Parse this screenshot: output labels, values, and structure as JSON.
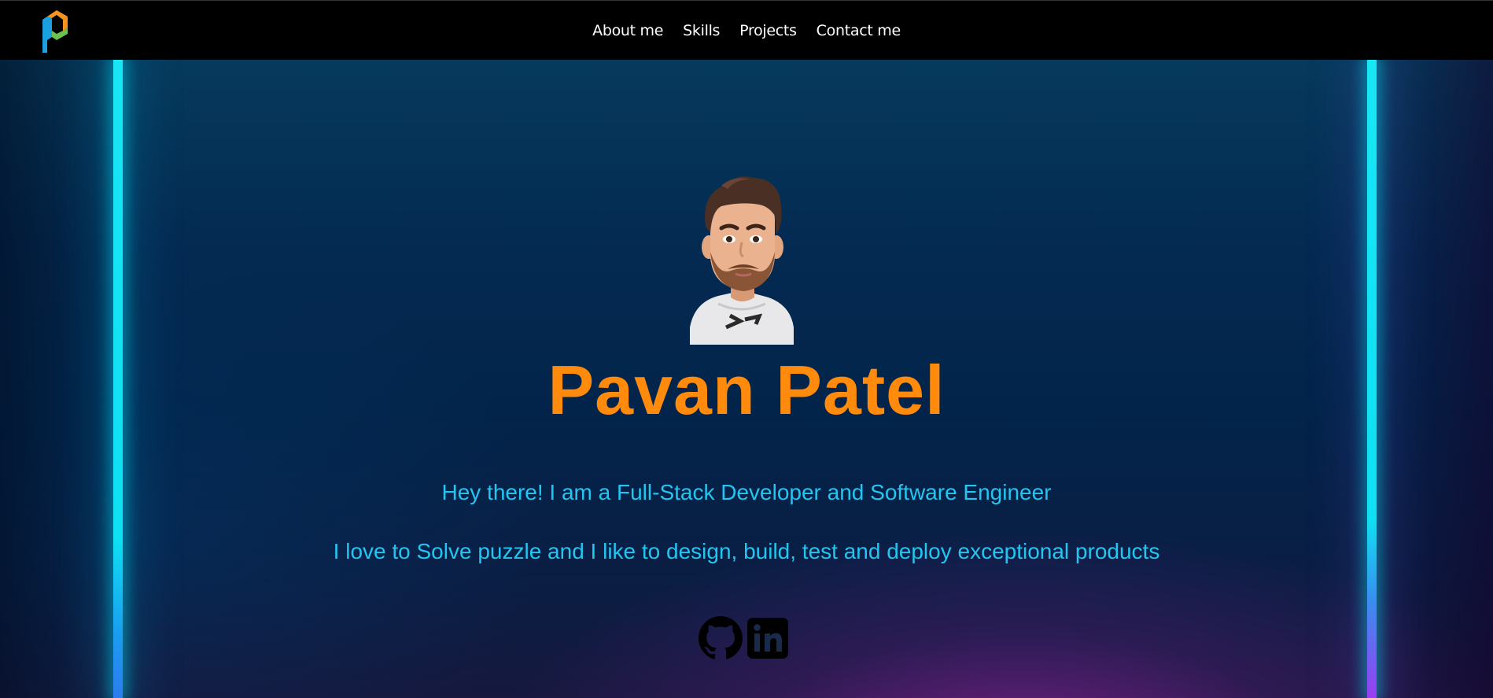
{
  "nav": {
    "links": [
      {
        "label": "About me"
      },
      {
        "label": "Skills"
      },
      {
        "label": "Projects"
      },
      {
        "label": "Contact me"
      }
    ],
    "logo_icon": "p-logo-icon"
  },
  "hero": {
    "avatar_icon": "memoji-avatar",
    "name": "Pavan Patel",
    "tagline_1": "Hey there! I am a Full-Stack Developer and Software Engineer",
    "tagline_2": "I love to Solve puzzle and I like to design, build, test and deploy exceptional products",
    "socials": [
      {
        "icon": "github-icon"
      },
      {
        "icon": "linkedin-icon"
      }
    ]
  },
  "colors": {
    "name": "#ff8a0c",
    "tagline": "#22c6f0",
    "neon": "#19e6f5",
    "navbar": "#000000"
  }
}
